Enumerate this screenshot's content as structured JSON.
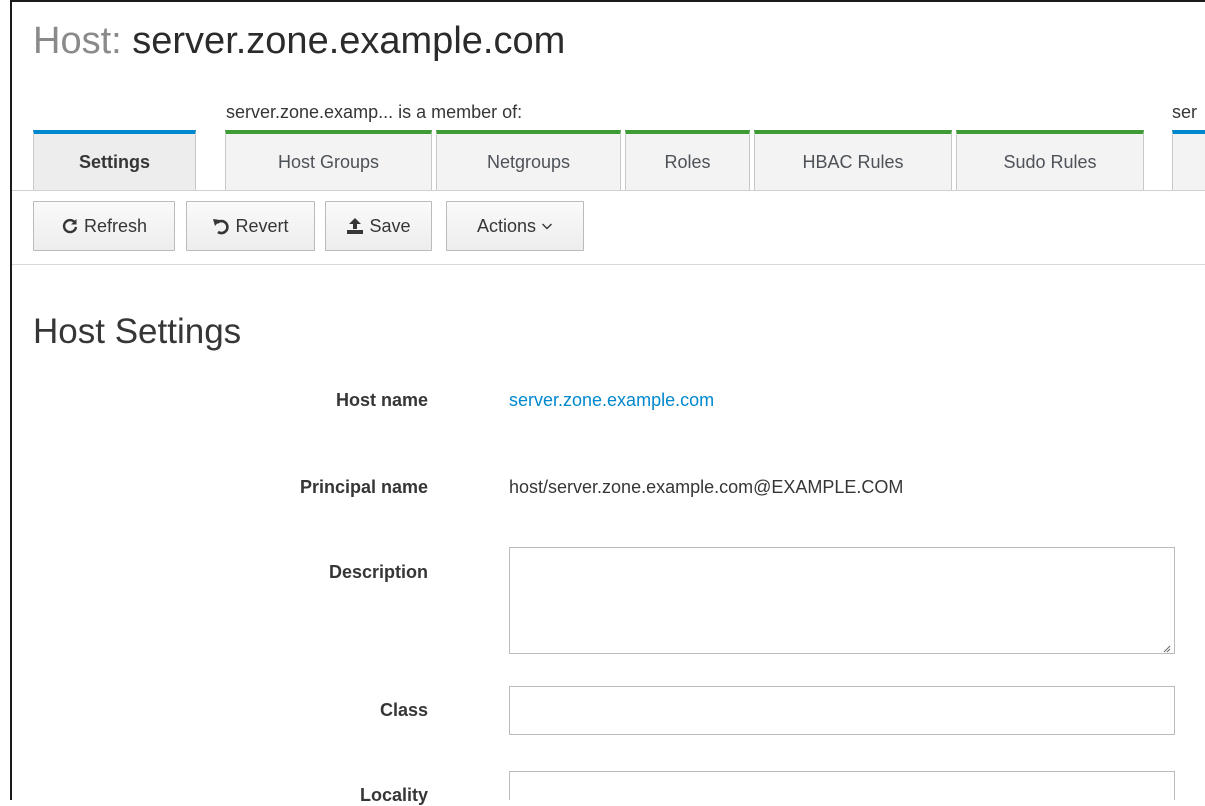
{
  "header": {
    "title_prefix": "Host:",
    "title_name": "server.zone.example.com"
  },
  "member_of_label": "server.zone.examp... is a member of:",
  "right_group_label": "ser",
  "tabs": [
    {
      "label": "Settings",
      "active": true
    },
    {
      "label": "Host Groups"
    },
    {
      "label": "Netgroups"
    },
    {
      "label": "Roles"
    },
    {
      "label": "HBAC Rules"
    },
    {
      "label": "Sudo Rules"
    },
    {
      "label": ""
    }
  ],
  "toolbar": {
    "refresh_label": "Refresh",
    "revert_label": "Revert",
    "save_label": "Save",
    "actions_label": "Actions"
  },
  "section": {
    "title": "Host Settings"
  },
  "fields": {
    "host_name": {
      "label": "Host name",
      "value": "server.zone.example.com"
    },
    "principal_name": {
      "label": "Principal name",
      "value": "host/server.zone.example.com@EXAMPLE.COM"
    },
    "description": {
      "label": "Description",
      "value": ""
    },
    "class": {
      "label": "Class",
      "value": ""
    },
    "locality": {
      "label": "Locality",
      "value": ""
    }
  },
  "colors": {
    "link": "#0088ce",
    "member_tab_accent": "#3f9c35",
    "settings_tab_accent": "#0088ce"
  }
}
